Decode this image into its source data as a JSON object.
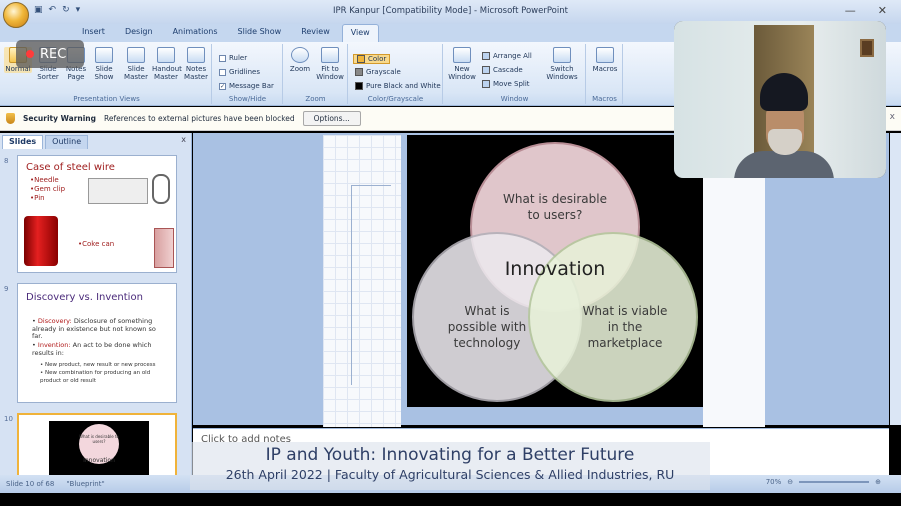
{
  "window": {
    "title": "IPR Kanpur [Compatibility Mode] - Microsoft PowerPoint",
    "minimize": "—",
    "close": "✕"
  },
  "recording": {
    "label": "REC"
  },
  "ribbon_tabs": [
    "Insert",
    "Design",
    "Animations",
    "Slide Show",
    "Review",
    "View"
  ],
  "ribbon": {
    "presentation_views": {
      "label": "Presentation Views",
      "buttons": [
        "Normal",
        "Slide Sorter",
        "Notes Page",
        "Slide Show",
        "Slide Master",
        "Handout Master",
        "Notes Master"
      ]
    },
    "show_hide": {
      "label": "Show/Hide",
      "items": [
        {
          "label": "Ruler",
          "checked": false
        },
        {
          "label": "Gridlines",
          "checked": false
        },
        {
          "label": "Message Bar",
          "checked": true
        }
      ]
    },
    "zoom": {
      "label": "Zoom",
      "buttons": [
        "Zoom",
        "Fit to Window"
      ]
    },
    "color_grayscale": {
      "label": "Color/Grayscale",
      "items": [
        "Color",
        "Grayscale",
        "Pure Black and White"
      ]
    },
    "window": {
      "label": "Window",
      "new_window": "New Window",
      "items": [
        "Arrange All",
        "Cascade",
        "Move Split"
      ],
      "switch": "Switch Windows"
    },
    "macros": {
      "label": "Macros",
      "button": "Macros"
    }
  },
  "security_bar": {
    "title": "Security Warning",
    "message": "References to external pictures have been blocked",
    "options_button": "Options...",
    "close": "x"
  },
  "slides_pane": {
    "tabs": [
      "Slides",
      "Outline"
    ],
    "close": "x",
    "thumbnails": [
      {
        "number": "8",
        "title": "Case of steel wire",
        "items": [
          "•Needle",
          "•Gem clip",
          "•Pin"
        ],
        "extra": "•Coke can"
      },
      {
        "number": "9",
        "title": "Discovery vs. Invention",
        "items": [
          {
            "term": "Discovery:",
            "text": " Disclosure of something already in existence but not known so far."
          },
          {
            "term": "Invention:",
            "text": " An act to be done which results in:"
          },
          {
            "term": "",
            "text": "New product, new result or new process"
          },
          {
            "term": "",
            "text": "New combination for producing an old product or old result"
          }
        ]
      },
      {
        "number": "10",
        "center": "Innovation",
        "top": "What is desirable to users?"
      }
    ]
  },
  "slide": {
    "top_circle": "What is desirable to users?",
    "center": "Innovation",
    "left_circle": "What is possible with technology",
    "right_circle": "What is viable in the marketplace"
  },
  "notes": {
    "placeholder": "Click to add notes"
  },
  "status": {
    "slide": "Slide 10 of 68",
    "theme": "\"Blueprint\"",
    "zoom": "70%"
  },
  "banner": {
    "title": "IP and Youth: Innovating for a Better Future",
    "subtitle": "26th April 2022  |  Faculty of Agricultural Sciences & Allied Industries, RU"
  },
  "colors": {
    "circle_pink": "#f3d7dd",
    "circle_gray": "#ece9ee",
    "circle_green": "#e7f1d8",
    "banner_text": "#2e3f66"
  }
}
